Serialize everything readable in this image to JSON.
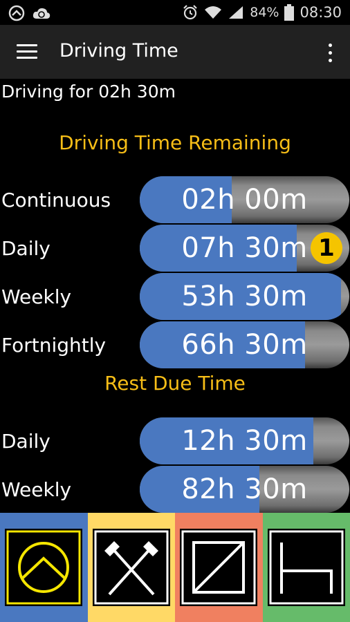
{
  "status_bar": {
    "battery": "84%",
    "time": "08:30",
    "icons": [
      "circle-logo-icon",
      "cloud-sync-icon",
      "alarm-icon",
      "wifi-icon",
      "signal-icon",
      "battery-icon"
    ]
  },
  "app_bar": {
    "title": "Driving Time",
    "icons": [
      "menu-icon",
      "overflow-menu-icon"
    ]
  },
  "driving_for": "Driving for 02h 30m",
  "remaining": {
    "title": "Driving Time Remaining",
    "rows": [
      {
        "label": "Continuous",
        "value": "02h 00m",
        "fill": 0.44
      },
      {
        "label": "Daily",
        "value": "07h 30m",
        "fill": 0.75,
        "badge": "1"
      },
      {
        "label": "Weekly",
        "value": "53h 30m",
        "fill": 0.96
      },
      {
        "label": "Fortnightly",
        "value": "66h 30m",
        "fill": 0.79
      }
    ]
  },
  "rest_due": {
    "title": "Rest Due Time",
    "rows": [
      {
        "label": "Daily",
        "value": "12h 30m",
        "fill": 0.83
      },
      {
        "label": "Weekly",
        "value": "82h 30m",
        "fill": 0.57
      }
    ]
  },
  "bottom_tabs": [
    {
      "name": "driving",
      "bg": "#4a78c0",
      "stroke": "#f5e600",
      "icon": "steering-wheel-icon"
    },
    {
      "name": "work",
      "bg": "#ffd966",
      "stroke": "#ffffff",
      "icon": "crossed-hammers-icon"
    },
    {
      "name": "availability",
      "bg": "#f08060",
      "stroke": "#ffffff",
      "icon": "availability-icon"
    },
    {
      "name": "rest",
      "bg": "#66bb6a",
      "stroke": "#ffffff",
      "icon": "bed-icon"
    }
  ]
}
